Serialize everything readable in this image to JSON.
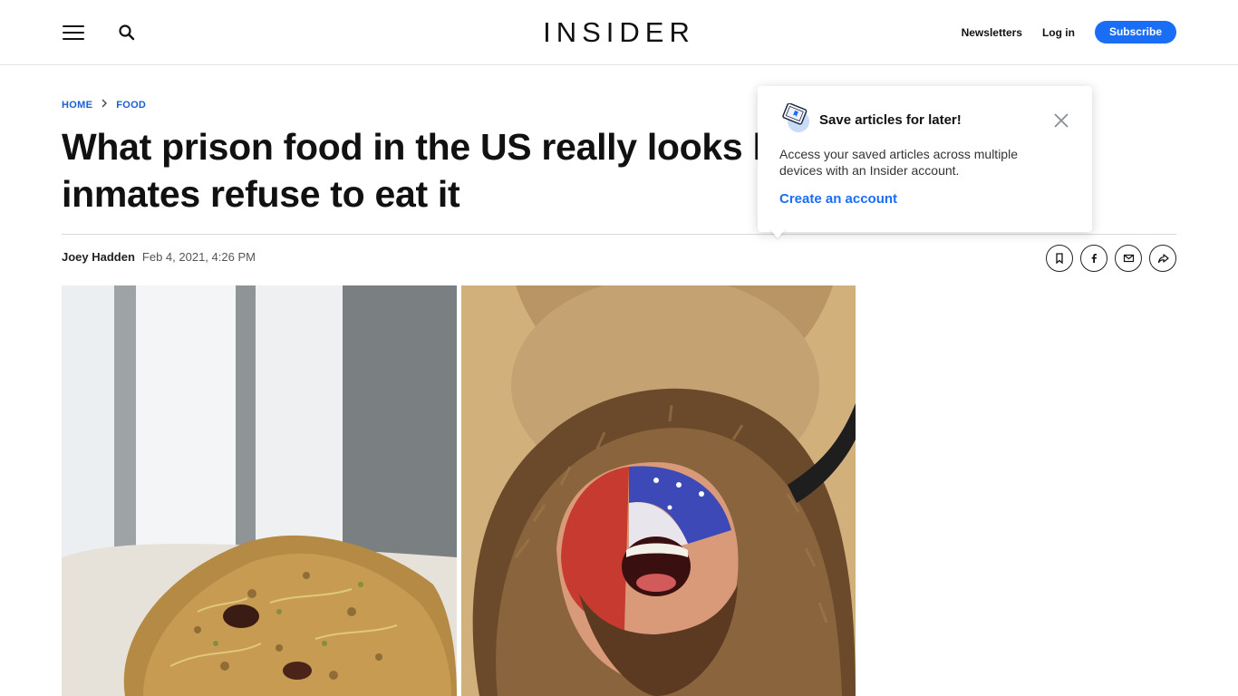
{
  "header": {
    "logo": "INSIDER",
    "newsletters_label": "Newsletters",
    "login_label": "Log in",
    "subscribe_label": "Subscribe",
    "accent_color": "#1a6ef5"
  },
  "breadcrumb": {
    "items": [
      "HOME",
      "FOOD"
    ]
  },
  "article": {
    "headline": "What prison food in the US really looks like, and why some inmates refuse to eat it",
    "author": "Joey Hadden",
    "date": "Feb 4, 2021, 4:26 PM"
  },
  "share_icons": [
    "bookmark-icon",
    "facebook-icon",
    "email-icon",
    "share-icon"
  ],
  "popover": {
    "title": "Save articles for later!",
    "body": "Access your saved articles across multiple devices with an Insider account.",
    "link_label": "Create an account"
  }
}
